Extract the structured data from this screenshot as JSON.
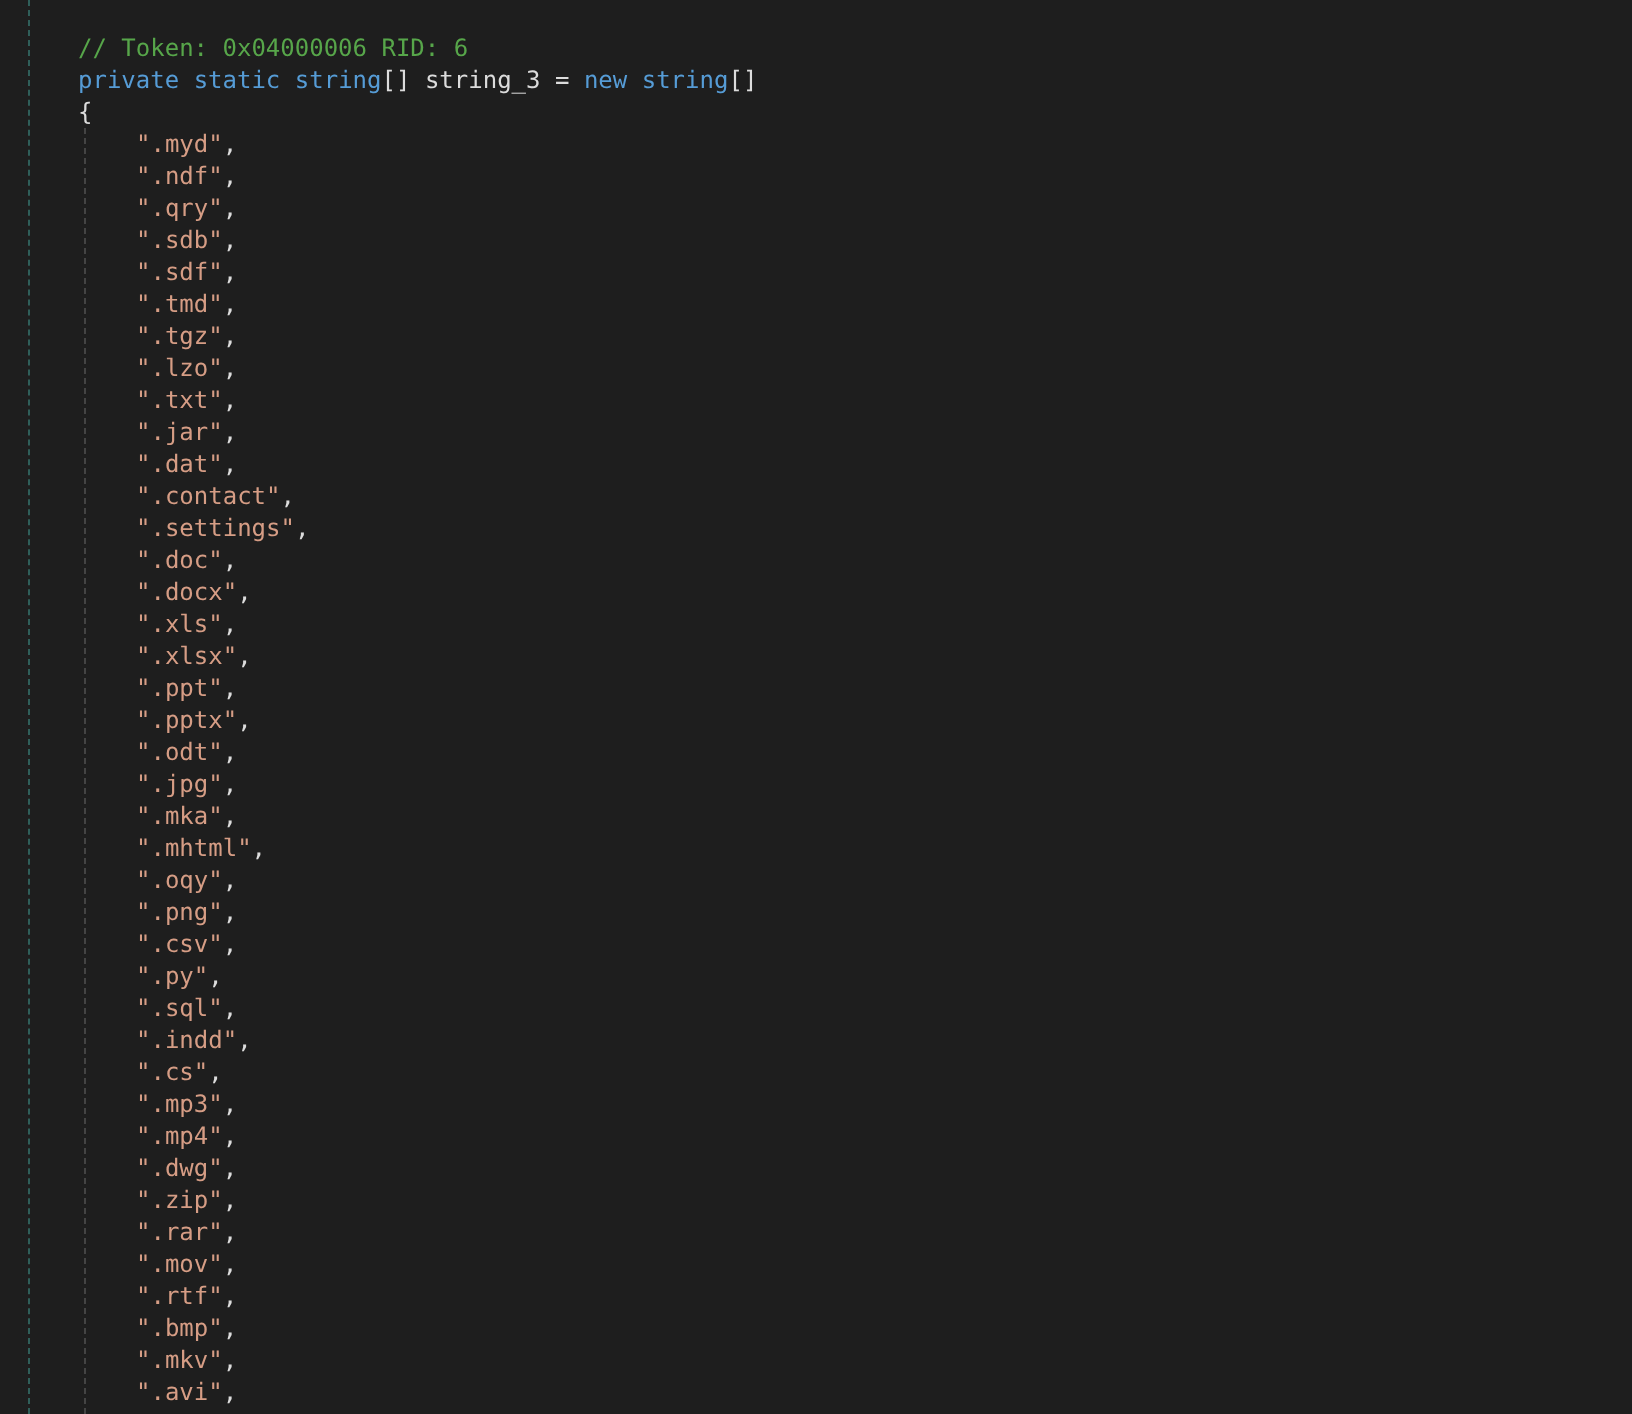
{
  "code_lines": [
    {
      "kind": "comment",
      "text": "// Token: 0x04000006 RID: 6"
    },
    {
      "kind": "declaration",
      "tokens": [
        {
          "kind": "keyword",
          "text": "private"
        },
        {
          "kind": "keyword",
          "text": "static"
        },
        {
          "kind": "keyword",
          "text": "string"
        },
        {
          "kind": "plain",
          "text": "[]"
        },
        {
          "kind": "plain",
          "text": " string_3 ="
        },
        {
          "kind": "keyword",
          "text": "new"
        },
        {
          "kind": "keyword",
          "text": "string"
        },
        {
          "kind": "plain",
          "text": "[]"
        }
      ]
    },
    {
      "kind": "brace",
      "text": "{"
    },
    {
      "kind": "item",
      "value": "\".myd\"",
      "punct": ","
    },
    {
      "kind": "item",
      "value": "\".ndf\"",
      "punct": ","
    },
    {
      "kind": "item",
      "value": "\".qry\"",
      "punct": ","
    },
    {
      "kind": "item",
      "value": "\".sdb\"",
      "punct": ","
    },
    {
      "kind": "item",
      "value": "\".sdf\"",
      "punct": ","
    },
    {
      "kind": "item",
      "value": "\".tmd\"",
      "punct": ","
    },
    {
      "kind": "item",
      "value": "\".tgz\"",
      "punct": ","
    },
    {
      "kind": "item",
      "value": "\".lzo\"",
      "punct": ","
    },
    {
      "kind": "item",
      "value": "\".txt\"",
      "punct": ","
    },
    {
      "kind": "item",
      "value": "\".jar\"",
      "punct": ","
    },
    {
      "kind": "item",
      "value": "\".dat\"",
      "punct": ","
    },
    {
      "kind": "item",
      "value": "\".contact\"",
      "punct": ","
    },
    {
      "kind": "item",
      "value": "\".settings\"",
      "punct": ","
    },
    {
      "kind": "item",
      "value": "\".doc\"",
      "punct": ","
    },
    {
      "kind": "item",
      "value": "\".docx\"",
      "punct": ","
    },
    {
      "kind": "item",
      "value": "\".xls\"",
      "punct": ","
    },
    {
      "kind": "item",
      "value": "\".xlsx\"",
      "punct": ","
    },
    {
      "kind": "item",
      "value": "\".ppt\"",
      "punct": ","
    },
    {
      "kind": "item",
      "value": "\".pptx\"",
      "punct": ","
    },
    {
      "kind": "item",
      "value": "\".odt\"",
      "punct": ","
    },
    {
      "kind": "item",
      "value": "\".jpg\"",
      "punct": ","
    },
    {
      "kind": "item",
      "value": "\".mka\"",
      "punct": ","
    },
    {
      "kind": "item",
      "value": "\".mhtml\"",
      "punct": ","
    },
    {
      "kind": "item",
      "value": "\".oqy\"",
      "punct": ","
    },
    {
      "kind": "item",
      "value": "\".png\"",
      "punct": ","
    },
    {
      "kind": "item",
      "value": "\".csv\"",
      "punct": ","
    },
    {
      "kind": "item",
      "value": "\".py\"",
      "punct": ","
    },
    {
      "kind": "item",
      "value": "\".sql\"",
      "punct": ","
    },
    {
      "kind": "item",
      "value": "\".indd\"",
      "punct": ","
    },
    {
      "kind": "item",
      "value": "\".cs\"",
      "punct": ","
    },
    {
      "kind": "item",
      "value": "\".mp3\"",
      "punct": ","
    },
    {
      "kind": "item",
      "value": "\".mp4\"",
      "punct": ","
    },
    {
      "kind": "item",
      "value": "\".dwg\"",
      "punct": ","
    },
    {
      "kind": "item",
      "value": "\".zip\"",
      "punct": ","
    },
    {
      "kind": "item",
      "value": "\".rar\"",
      "punct": ","
    },
    {
      "kind": "item",
      "value": "\".mov\"",
      "punct": ","
    },
    {
      "kind": "item",
      "value": "\".rtf\"",
      "punct": ","
    },
    {
      "kind": "item",
      "value": "\".bmp\"",
      "punct": ","
    },
    {
      "kind": "item",
      "value": "\".mkv\"",
      "punct": ","
    },
    {
      "kind": "item",
      "value": "\".avi\"",
      "punct": ","
    }
  ]
}
